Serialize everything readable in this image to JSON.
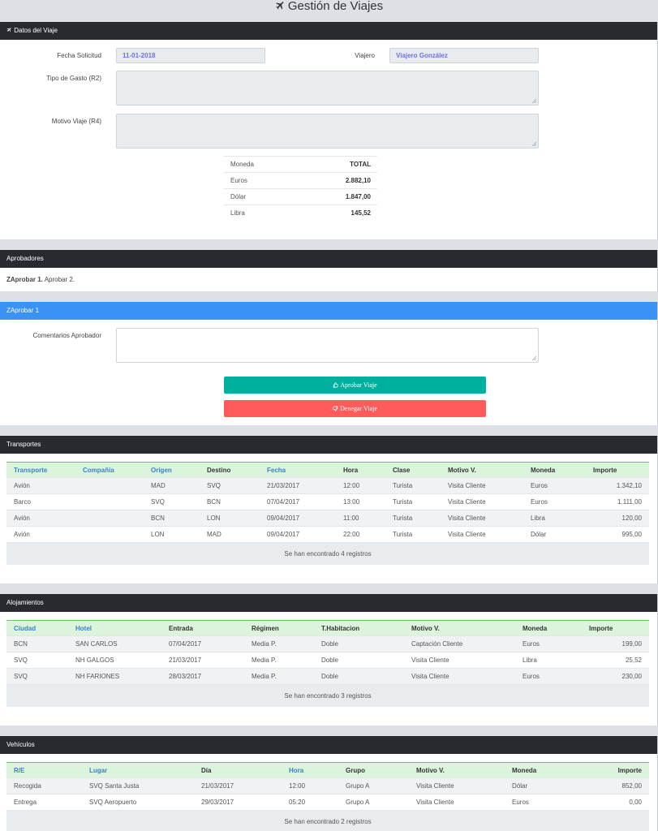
{
  "page": {
    "title": "Gestión de Viajes"
  },
  "datos": {
    "header": "Datos del Viaje",
    "fecha_label": "Fecha Solicitud",
    "fecha_value": "11-01-2018",
    "viajero_label": "Viajero",
    "viajero_value": "Viajero González",
    "tipo_label": "Tipo de Gasto (R2)",
    "motivo_label": "Motivo Viaje (R4)",
    "totales": {
      "col_moneda": "Moneda",
      "col_total": "TOTAL",
      "rows": [
        {
          "moneda": "Euros",
          "total": "2.882,10"
        },
        {
          "moneda": "Dólar",
          "total": "1.847,00"
        },
        {
          "moneda": "Libra",
          "total": "145,52"
        }
      ]
    }
  },
  "aprobadores": {
    "header": "Aprobadores",
    "strong": "ZAprobar 1.",
    "rest": " Aprobar 2."
  },
  "zaprobar": {
    "header": "ZAprobar 1",
    "comentarios_label": "Comentarios Aprobador",
    "aprobar_label": "Aprobar Viaje",
    "denegar_label": "Denegar Viaje"
  },
  "transportes": {
    "header": "Transportes",
    "columns": [
      "Transporte",
      "Compañía",
      "Origen",
      "Destino",
      "Fecha",
      "Hora",
      "Clase",
      "Motivo V.",
      "Moneda",
      "Importe"
    ],
    "rows": [
      [
        "Avión",
        "",
        "MAD",
        "SVQ",
        "21/03/2017",
        "12:00",
        "Turista",
        "Visita Cliente",
        "Euros",
        "1.342,10"
      ],
      [
        "Barco",
        "",
        "SVQ",
        "BCN",
        "07/04/2017",
        "13:00",
        "Turista",
        "Visita Cliente",
        "Euros",
        "1.111,00"
      ],
      [
        "Avión",
        "",
        "BCN",
        "LON",
        "09/04/2017",
        "11:00",
        "Turista",
        "Visita Cliente",
        "Libra",
        "120,00"
      ],
      [
        "Avión",
        "",
        "LON",
        "MAD",
        "09/04/2017",
        "22:00",
        "Turista",
        "Visita Cliente",
        "Dólar",
        "995,00"
      ]
    ],
    "footer": "Se han encontrado 4 registros"
  },
  "alojamientos": {
    "header": "Alojamientos",
    "columns": [
      "Ciudad",
      "Hotel",
      "Entrada",
      "Régimen",
      "T.Habitacion",
      "Motivo V.",
      "Moneda",
      "Importe"
    ],
    "rows": [
      [
        "BCN",
        "SAN CARLOS",
        "07/04/2017",
        "Media P.",
        "Doble",
        "Captación Cliente",
        "Euros",
        "199,00"
      ],
      [
        "SVQ",
        "NH GALGOS",
        "21/03/2017",
        "Media P.",
        "Doble",
        "Visita Cliente",
        "Libra",
        "25,52"
      ],
      [
        "SVQ",
        "NH FARIONES",
        "28/03/2017",
        "Media P.",
        "Doble",
        "Visita Cliente",
        "Euros",
        "230,00"
      ]
    ],
    "footer": "Se han encontrado 3 registros"
  },
  "vehiculos": {
    "header": "Vehículos",
    "columns": [
      "R/E",
      "Lugar",
      "Día",
      "Hora",
      "Grupo",
      "Motivo V.",
      "Moneda",
      "Importe"
    ],
    "rows": [
      [
        "Recogida",
        "SVQ Santa Justa",
        "21/03/2017",
        "12:00",
        "Grupo A",
        "Visita Cliente",
        "Dólar",
        "852,00"
      ],
      [
        "Entrega",
        "SVQ Aeropuerto",
        "29/03/2017",
        "05:20",
        "Grupo A",
        "Visita Cliente",
        "Euros",
        "0,00"
      ]
    ],
    "footer": "Se han encontrado 2 registros"
  },
  "colors": {
    "header_dark": "#272b30",
    "header_blue": "#3a92f4",
    "approve": "#00b09f",
    "deny": "#ff5b5b",
    "table_head": "#dcf4dc",
    "sort_link": "#3a82c8"
  },
  "icons": {
    "title": "plane-icon",
    "datos": "plane-icon",
    "aprobar": "thumbs-up-icon",
    "denegar": "thumbs-down-icon"
  }
}
